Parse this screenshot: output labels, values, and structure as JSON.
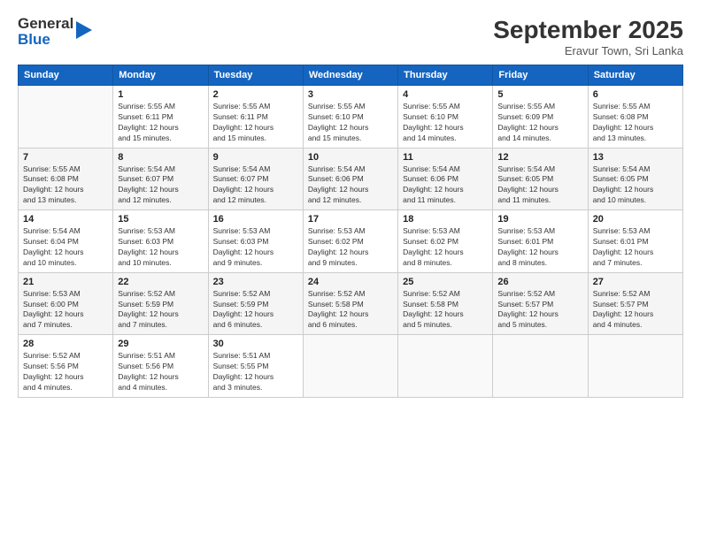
{
  "header": {
    "logo_line1": "General",
    "logo_line2": "Blue",
    "month": "September 2025",
    "location": "Eravur Town, Sri Lanka"
  },
  "days_of_week": [
    "Sunday",
    "Monday",
    "Tuesday",
    "Wednesday",
    "Thursday",
    "Friday",
    "Saturday"
  ],
  "weeks": [
    [
      {
        "day": "",
        "info": ""
      },
      {
        "day": "1",
        "info": "Sunrise: 5:55 AM\nSunset: 6:11 PM\nDaylight: 12 hours\nand 15 minutes."
      },
      {
        "day": "2",
        "info": "Sunrise: 5:55 AM\nSunset: 6:11 PM\nDaylight: 12 hours\nand 15 minutes."
      },
      {
        "day": "3",
        "info": "Sunrise: 5:55 AM\nSunset: 6:10 PM\nDaylight: 12 hours\nand 15 minutes."
      },
      {
        "day": "4",
        "info": "Sunrise: 5:55 AM\nSunset: 6:10 PM\nDaylight: 12 hours\nand 14 minutes."
      },
      {
        "day": "5",
        "info": "Sunrise: 5:55 AM\nSunset: 6:09 PM\nDaylight: 12 hours\nand 14 minutes."
      },
      {
        "day": "6",
        "info": "Sunrise: 5:55 AM\nSunset: 6:08 PM\nDaylight: 12 hours\nand 13 minutes."
      }
    ],
    [
      {
        "day": "7",
        "info": "Sunrise: 5:55 AM\nSunset: 6:08 PM\nDaylight: 12 hours\nand 13 minutes."
      },
      {
        "day": "8",
        "info": "Sunrise: 5:54 AM\nSunset: 6:07 PM\nDaylight: 12 hours\nand 12 minutes."
      },
      {
        "day": "9",
        "info": "Sunrise: 5:54 AM\nSunset: 6:07 PM\nDaylight: 12 hours\nand 12 minutes."
      },
      {
        "day": "10",
        "info": "Sunrise: 5:54 AM\nSunset: 6:06 PM\nDaylight: 12 hours\nand 12 minutes."
      },
      {
        "day": "11",
        "info": "Sunrise: 5:54 AM\nSunset: 6:06 PM\nDaylight: 12 hours\nand 11 minutes."
      },
      {
        "day": "12",
        "info": "Sunrise: 5:54 AM\nSunset: 6:05 PM\nDaylight: 12 hours\nand 11 minutes."
      },
      {
        "day": "13",
        "info": "Sunrise: 5:54 AM\nSunset: 6:05 PM\nDaylight: 12 hours\nand 10 minutes."
      }
    ],
    [
      {
        "day": "14",
        "info": "Sunrise: 5:54 AM\nSunset: 6:04 PM\nDaylight: 12 hours\nand 10 minutes."
      },
      {
        "day": "15",
        "info": "Sunrise: 5:53 AM\nSunset: 6:03 PM\nDaylight: 12 hours\nand 10 minutes."
      },
      {
        "day": "16",
        "info": "Sunrise: 5:53 AM\nSunset: 6:03 PM\nDaylight: 12 hours\nand 9 minutes."
      },
      {
        "day": "17",
        "info": "Sunrise: 5:53 AM\nSunset: 6:02 PM\nDaylight: 12 hours\nand 9 minutes."
      },
      {
        "day": "18",
        "info": "Sunrise: 5:53 AM\nSunset: 6:02 PM\nDaylight: 12 hours\nand 8 minutes."
      },
      {
        "day": "19",
        "info": "Sunrise: 5:53 AM\nSunset: 6:01 PM\nDaylight: 12 hours\nand 8 minutes."
      },
      {
        "day": "20",
        "info": "Sunrise: 5:53 AM\nSunset: 6:01 PM\nDaylight: 12 hours\nand 7 minutes."
      }
    ],
    [
      {
        "day": "21",
        "info": "Sunrise: 5:53 AM\nSunset: 6:00 PM\nDaylight: 12 hours\nand 7 minutes."
      },
      {
        "day": "22",
        "info": "Sunrise: 5:52 AM\nSunset: 5:59 PM\nDaylight: 12 hours\nand 7 minutes."
      },
      {
        "day": "23",
        "info": "Sunrise: 5:52 AM\nSunset: 5:59 PM\nDaylight: 12 hours\nand 6 minutes."
      },
      {
        "day": "24",
        "info": "Sunrise: 5:52 AM\nSunset: 5:58 PM\nDaylight: 12 hours\nand 6 minutes."
      },
      {
        "day": "25",
        "info": "Sunrise: 5:52 AM\nSunset: 5:58 PM\nDaylight: 12 hours\nand 5 minutes."
      },
      {
        "day": "26",
        "info": "Sunrise: 5:52 AM\nSunset: 5:57 PM\nDaylight: 12 hours\nand 5 minutes."
      },
      {
        "day": "27",
        "info": "Sunrise: 5:52 AM\nSunset: 5:57 PM\nDaylight: 12 hours\nand 4 minutes."
      }
    ],
    [
      {
        "day": "28",
        "info": "Sunrise: 5:52 AM\nSunset: 5:56 PM\nDaylight: 12 hours\nand 4 minutes."
      },
      {
        "day": "29",
        "info": "Sunrise: 5:51 AM\nSunset: 5:56 PM\nDaylight: 12 hours\nand 4 minutes."
      },
      {
        "day": "30",
        "info": "Sunrise: 5:51 AM\nSunset: 5:55 PM\nDaylight: 12 hours\nand 3 minutes."
      },
      {
        "day": "",
        "info": ""
      },
      {
        "day": "",
        "info": ""
      },
      {
        "day": "",
        "info": ""
      },
      {
        "day": "",
        "info": ""
      }
    ]
  ]
}
